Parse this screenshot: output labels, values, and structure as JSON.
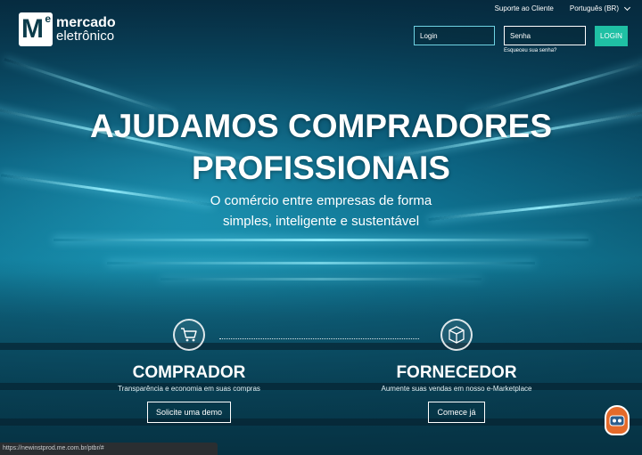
{
  "header": {
    "logo": {
      "line1": "mercado",
      "line2": "eletrônico",
      "mark_m": "M",
      "mark_e": "e"
    },
    "support_label": "Suporte ao Cliente",
    "language_label": "Português (BR)",
    "login": {
      "login_placeholder": "Login",
      "password_placeholder": "Senha",
      "button_label": "LOGIN",
      "forgot_label": "Esqueceu sua senha?"
    }
  },
  "hero": {
    "headline_line1": "AJUDAMOS COMPRADORES",
    "headline_line2": "PROFISSIONAIS",
    "subline_line1": "O comércio entre empresas de forma",
    "subline_line2": "simples, inteligente e sustentável"
  },
  "buyer": {
    "icon": "shopping-cart-icon",
    "title": "COMPRADOR",
    "description": "Transparência e economia em suas compras",
    "button_label": "Solicite uma demo"
  },
  "supplier": {
    "icon": "box-icon",
    "title": "FORNECEDOR",
    "description": "Aumente suas vendas em nosso e-Marketplace",
    "button_label": "Comece já"
  },
  "status_bar": {
    "url": "https://newinstprod.me.com.br/ptbr/#"
  },
  "colors": {
    "accent": "#1fc0a4",
    "login_field_focus": "#6fd3e3"
  }
}
